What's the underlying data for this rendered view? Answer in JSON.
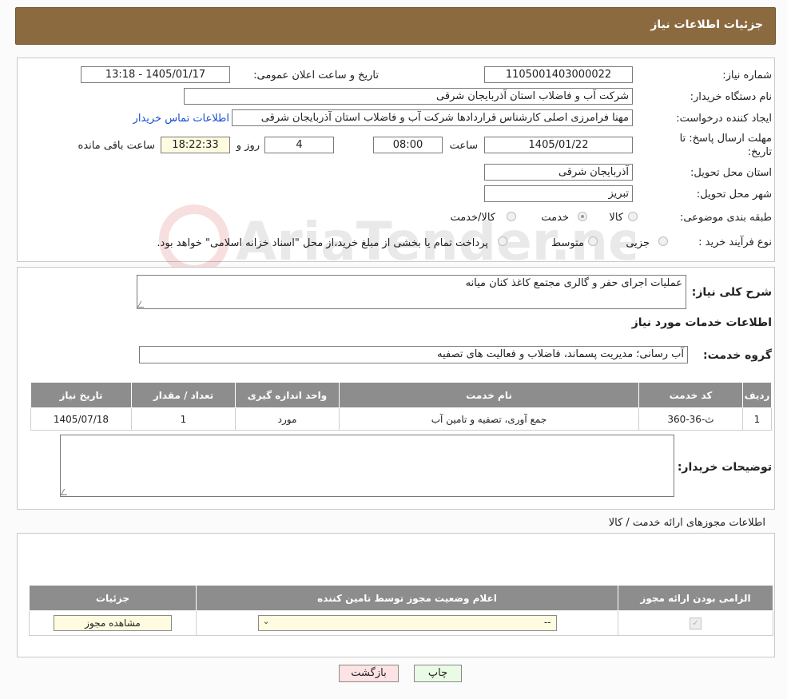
{
  "header": {
    "title": "جزئیات اطلاعات نیاز"
  },
  "form": {
    "need_number": {
      "label": "شماره نیاز:",
      "value": "1105001403000022"
    },
    "announce_datetime": {
      "label": "تاریخ و ساعت اعلان عمومی:",
      "value": "1405/01/17 - 13:18"
    },
    "buyer_org": {
      "label": "نام دستگاه خریدار:",
      "value": "شرکت آب و فاضلاب استان آذربایجان شرقی"
    },
    "requester": {
      "label": "ایجاد کننده درخواست:",
      "value": "مهنا فرامرزی اصلی کارشناس قراردادها شرکت آب و فاضلاب استان آذربایجان شرقی",
      "contact_link": "اطلاعات تماس خریدار"
    },
    "deadline": {
      "label_line1": "مهلت ارسال پاسخ: تا",
      "label_line2": "تاریخ:",
      "date": "1405/01/22",
      "time_label": "ساعت",
      "time": "08:00",
      "days": "4",
      "days_label": "روز و",
      "remaining": "18:22:33",
      "remaining_label": "ساعت باقی مانده"
    },
    "delivery_province": {
      "label": "استان محل تحویل:",
      "value": "آذربایجان شرقی"
    },
    "delivery_city": {
      "label": "شهر محل تحویل:",
      "value": "تبریز"
    },
    "category": {
      "label": "طبقه بندی موضوعی:",
      "options": [
        "کالا",
        "خدمت",
        "کالا/خدمت"
      ],
      "selected": "خدمت"
    },
    "purchase_process": {
      "label": "نوع فرآیند خرید :",
      "options": [
        "جزیی",
        "متوسط"
      ],
      "note": "پرداخت تمام یا بخشی از مبلغ خرید،از محل \"اسناد خزانه اسلامی\" خواهد بود."
    }
  },
  "general": {
    "description_label": "شرح کلی نیاز:",
    "description": "عملیات اجرای حفر و گالری مجتمع کاغذ کنان میانه",
    "services_title": "اطلاعات خدمات مورد نیاز",
    "service_group_label": "گروه خدمت:",
    "service_group": "آب رسانی؛ مدیریت پسماند، فاضلاب و فعالیت های تصفیه",
    "table": {
      "headers": [
        "ردیف",
        "کد خدمت",
        "نام خدمت",
        "واحد اندازه گیری",
        "تعداد / مقدار",
        "تاریخ نیاز"
      ],
      "rows": [
        [
          "1",
          "ث-36-360",
          "جمع آوری، تصفیه و تامین آب",
          "مورد",
          "1",
          "1405/07/18"
        ]
      ]
    },
    "buyer_notes_label": "توضیحات خریدار:",
    "buyer_notes": ""
  },
  "permits": {
    "title": "اطلاعات مجوزهای ارائه خدمت / کالا",
    "headers": [
      "الزامی بودن ارائه مجوز",
      "اعلام وضعیت مجوز توسط تامین کننده",
      "جزئیات"
    ],
    "select_value": "--",
    "view_button": "مشاهده مجوز"
  },
  "actions": {
    "print": "چاپ",
    "back": "بازگشت"
  },
  "watermark": "AriaTender.net"
}
